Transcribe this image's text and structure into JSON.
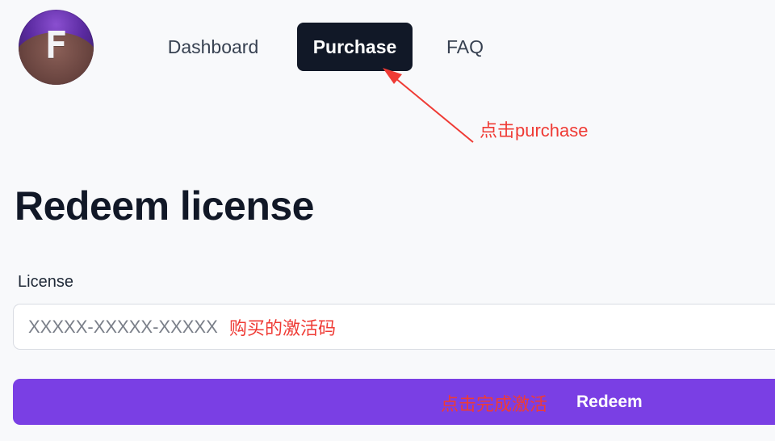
{
  "logo": {
    "letter": "F"
  },
  "nav": {
    "items": [
      {
        "label": "Dashboard",
        "active": false
      },
      {
        "label": "Purchase",
        "active": true
      },
      {
        "label": "FAQ",
        "active": false
      }
    ]
  },
  "annotations": {
    "purchase": "点击purchase",
    "input": "购买的激活码",
    "redeem": "点击完成激活",
    "color": "#ef3b35"
  },
  "main": {
    "title": "Redeem license",
    "license_label": "License",
    "license_placeholder": "XXXXX-XXXXX-XXXXX",
    "license_value": "",
    "redeem_label": "Redeem"
  },
  "colors": {
    "accent": "#7a3fe4",
    "nav_active_bg": "#111827",
    "page_bg": "#f8f9fb"
  }
}
